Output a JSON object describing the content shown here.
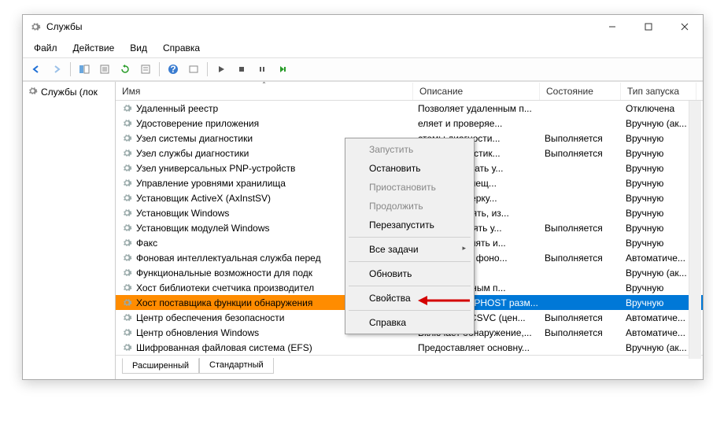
{
  "window": {
    "title": "Службы"
  },
  "menubar": [
    "Файл",
    "Действие",
    "Вид",
    "Справка"
  ],
  "sidebar": {
    "label": "Службы (лок"
  },
  "columns": {
    "name": "Имя",
    "desc": "Описание",
    "state": "Состояние",
    "start": "Тип запуска"
  },
  "rows": [
    {
      "name": "Удаленный реестр",
      "desc": "Позволяет удаленным п...",
      "state": "",
      "start": "Отключена"
    },
    {
      "name": "Удостоверение приложения",
      "desc": "еляет и проверяе...",
      "state": "",
      "start": "Вручную (ак..."
    },
    {
      "name": "Узел системы диагностики",
      "desc": "стемы диагности...",
      "state": "Выполняется",
      "start": "Вручную"
    },
    {
      "name": "Узел службы диагностики",
      "desc": "ужбы диагностик...",
      "state": "Выполняется",
      "start": "Вручную"
    },
    {
      "name": "Узел универсальных PNP-устройств",
      "desc": "ляет размещать у...",
      "state": "",
      "start": "Вручную"
    },
    {
      "name": "Управление уровнями хранилища",
      "desc": "изирует размещ...",
      "state": "",
      "start": "Вручную"
    },
    {
      "name": "Установщик ActiveX (AxInstSV)",
      "desc": "чивает проверку...",
      "state": "",
      "start": "Вручную"
    },
    {
      "name": "Установщик Windows",
      "desc": "ляет добавлять, из...",
      "state": "",
      "start": "Вручную"
    },
    {
      "name": "Установщик модулей Windows",
      "desc": "ляет выполнять у...",
      "state": "Выполняется",
      "start": "Вручную"
    },
    {
      "name": "Факс",
      "desc": "ляет отправлять и...",
      "state": "",
      "start": "Вручную"
    },
    {
      "name": "Фоновая интеллектуальная служба перед",
      "desc": "ает файлы в фоно...",
      "state": "Выполняется",
      "start": "Автоматиче..."
    },
    {
      "name": "Функциональные возможности для подк",
      "desc": "",
      "state": "",
      "start": "Вручную (ак..."
    },
    {
      "name": "Хост библиотеки счетчика производител",
      "desc": "ляет удаленным п...",
      "state": "",
      "start": "Вручную"
    },
    {
      "name": "Хост поставщика функции обнаружения",
      "desc": "В службе FDPHOST разм...",
      "state": "",
      "start": "Вручную",
      "selected": true
    },
    {
      "name": "Центр обеспечения безопасности",
      "desc": "Служба WSCSVC (цен...",
      "state": "Выполняется",
      "start": "Автоматиче..."
    },
    {
      "name": "Центр обновления Windows",
      "desc": "Включает обнаружение,...",
      "state": "Выполняется",
      "start": "Автоматиче..."
    },
    {
      "name": "Шифрованная файловая система (EFS)",
      "desc": "Предоставляет основну...",
      "state": "",
      "start": "Вручную (ак..."
    }
  ],
  "tabs": {
    "extended": "Расширенный",
    "standard": "Стандартный"
  },
  "context_menu": {
    "start": "Запустить",
    "stop": "Остановить",
    "pause": "Приостановить",
    "resume": "Продолжить",
    "restart": "Перезапустить",
    "alltasks": "Все задачи",
    "refresh": "Обновить",
    "properties": "Свойства",
    "help": "Справка"
  }
}
